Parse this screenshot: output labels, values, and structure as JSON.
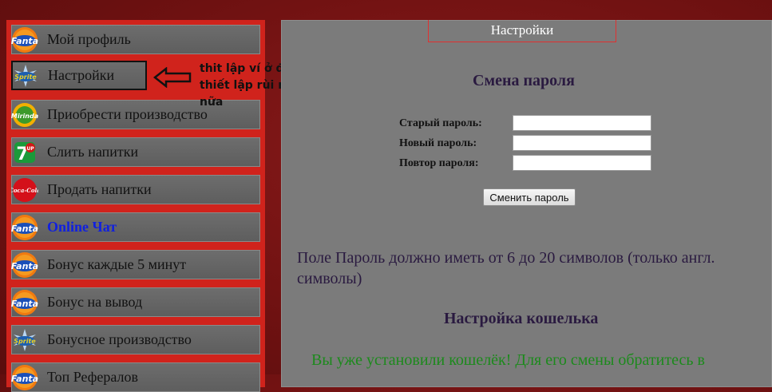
{
  "sidebar": {
    "items": [
      {
        "label": "Мой профиль",
        "icon": "fanta-logo-icon"
      },
      {
        "label": "Настройки",
        "icon": "sprite-logo-icon"
      },
      {
        "label": "Приобрести производство",
        "icon": "mirinda-logo-icon"
      },
      {
        "label": "Слить напитки",
        "icon": "7up-logo-icon"
      },
      {
        "label": "Продать напитки",
        "icon": "coca-cola-logo-icon"
      },
      {
        "label": "Online Чат",
        "icon": "fanta-logo-icon"
      },
      {
        "label": "Бонус каждые 5 минут",
        "icon": "fanta-logo-icon"
      },
      {
        "label": "Бонус на вывод",
        "icon": "fanta-logo-icon"
      },
      {
        "label": "Бонусное производство",
        "icon": "sprite-logo-icon"
      },
      {
        "label": "Топ Рефералов",
        "icon": "fanta-logo-icon"
      }
    ]
  },
  "annotation": {
    "text": "thit lập ví ở đâu nhé, minh thiết lập rùi nên nó ko hiện nữa",
    "arrow_icon": "left-arrow-icon"
  },
  "main": {
    "tab_title": "Настройки",
    "password_section": {
      "heading": "Смена пароля",
      "old_label": "Старый пароль:",
      "new_label": "Новый пароль:",
      "repeat_label": "Повтор пароля:",
      "old_value": "",
      "new_value": "",
      "repeat_value": "",
      "submit_label": "Сменить пароль"
    },
    "password_note": "Поле Пароль должно иметь от 6 до 20 символов (только англ. символы)",
    "wallet_section": {
      "heading": "Настройка кошелька",
      "message": "Вы уже установили кошелёк! Для его смены обратитесь в"
    }
  },
  "colors": {
    "sidebar_bg": "#d0231c",
    "menu_item_bg": "#656565",
    "panel_bg": "#7b7b7b",
    "heading_text": "#2a1a40",
    "success_text": "#1c8a1c",
    "chat_link": "#1020e0"
  }
}
